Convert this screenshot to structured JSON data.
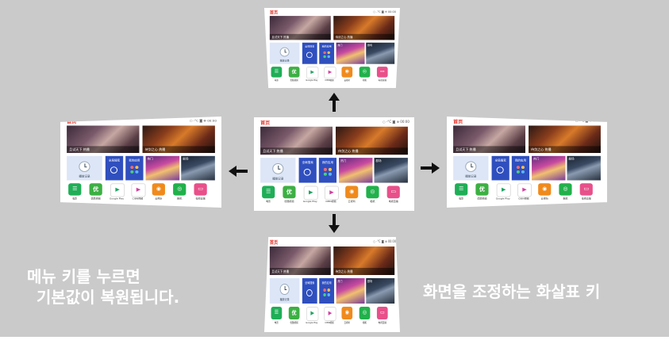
{
  "captions": {
    "left_line1": "메뉴 키를 누르면",
    "left_line2": "기본값이 복원됩니다.",
    "right": "화면을 조정하는 화살표 키"
  },
  "tv": {
    "home_label": "首页",
    "status": "○ -°C  ◙  ⊕  00:00",
    "posters": {
      "left_caption": "且试天下 热播",
      "right_caption": "侍剑之心 热播"
    },
    "clock_tile_label": "播放记录",
    "search_tile_label": "全局搜索",
    "apps_tile_label": "我的应用",
    "pic_tile_1_label": "热门",
    "pic_tile_2_label": "剧场",
    "apps": [
      {
        "label": "电影",
        "glyph": "☰",
        "color": "#1fae57"
      },
      {
        "label": "优酷视频",
        "glyph": "优",
        "color": "#3cb043"
      },
      {
        "label": "Google Play",
        "glyph": "▶",
        "color": "#ffffff"
      },
      {
        "label": "CIBN视频",
        "glyph": "▶",
        "color": "#ffffff"
      },
      {
        "label": "云视听",
        "glyph": "◉",
        "color": "#f08a1c"
      },
      {
        "label": "相机",
        "glyph": "◎",
        "color": "#21b14b"
      },
      {
        "label": "电视直播",
        "glyph": "▭",
        "color": "#e8508a"
      }
    ]
  },
  "arrows": {
    "color": "#111111"
  }
}
